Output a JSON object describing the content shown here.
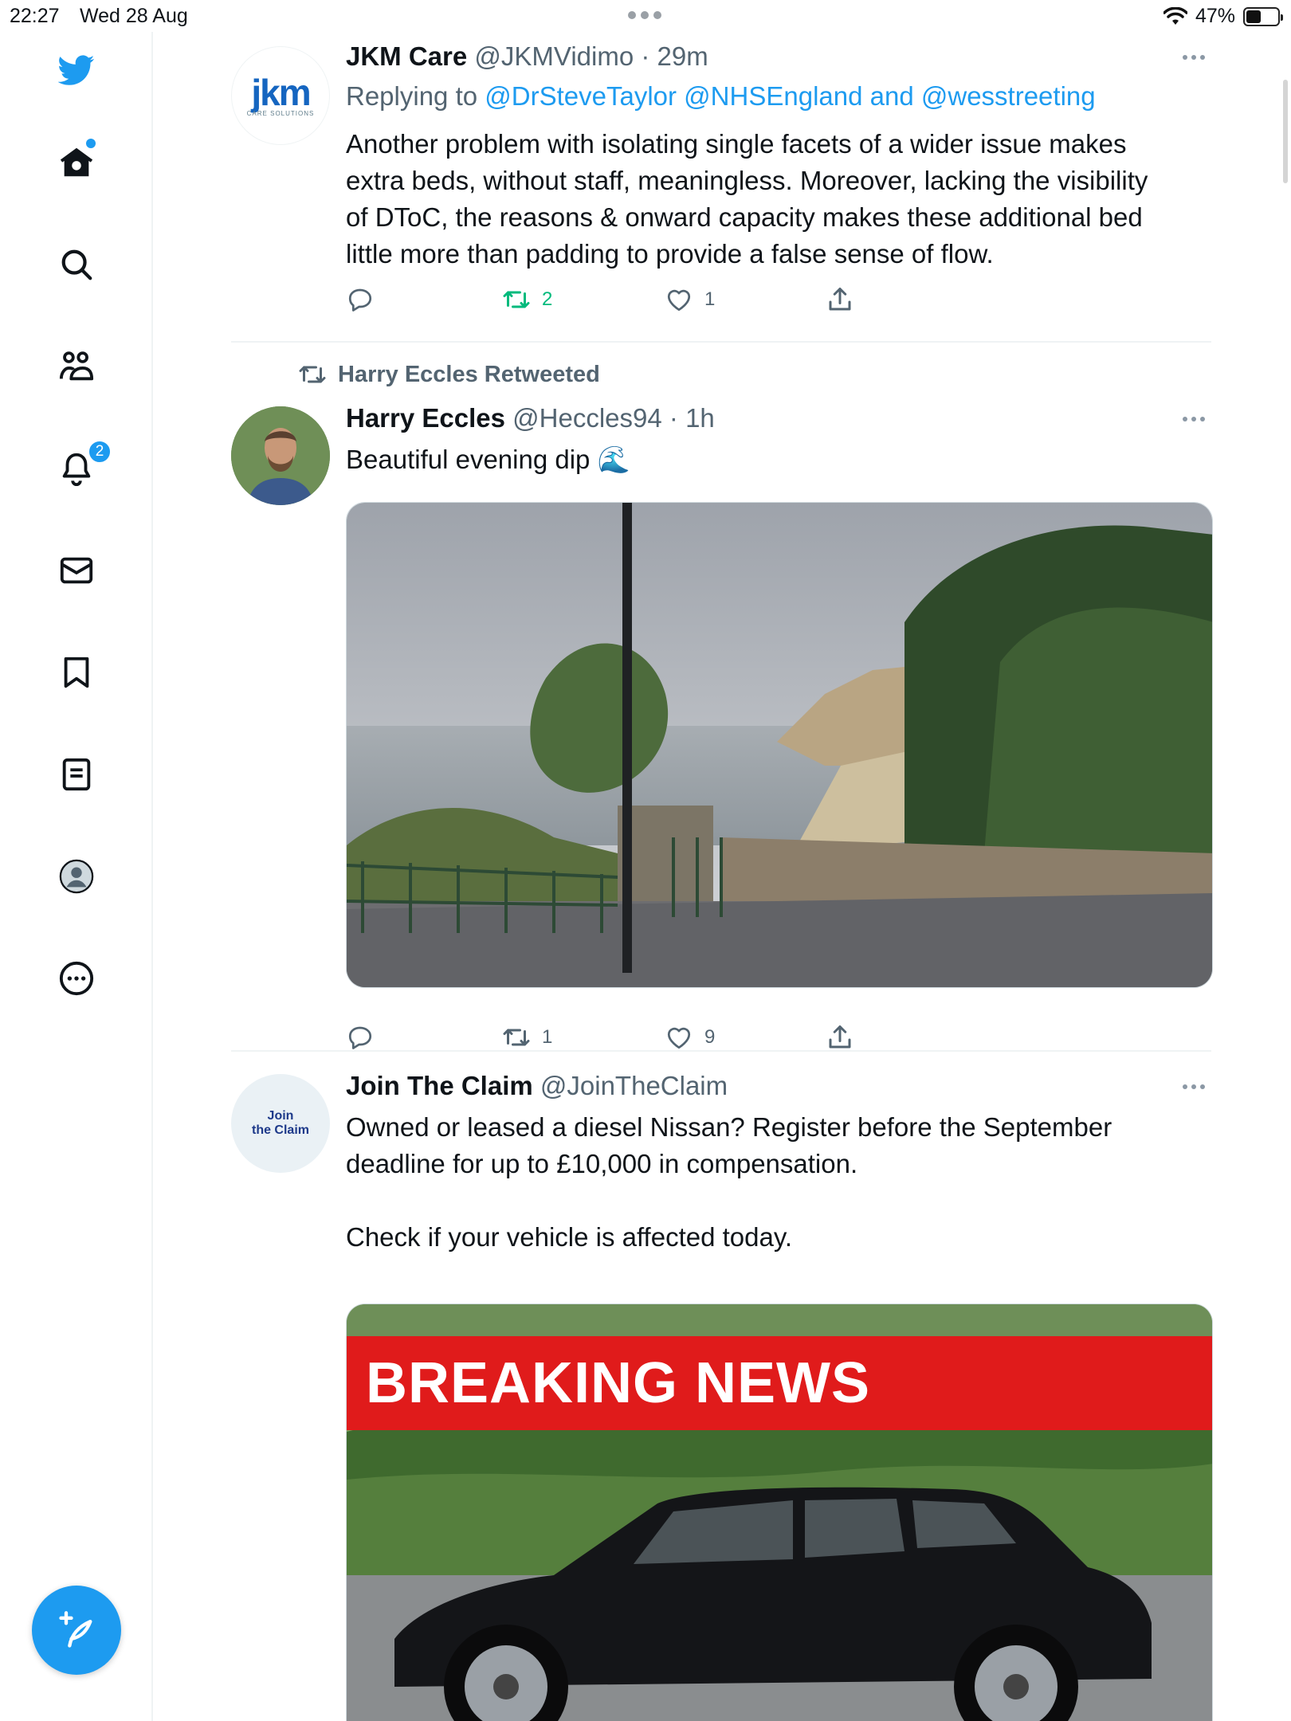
{
  "status_bar": {
    "time": "22:27",
    "date": "Wed 28 Aug",
    "battery": "47%",
    "battery_level": 0.47
  },
  "sidebar": {
    "items": [
      {
        "name": "home",
        "icon": "home-icon",
        "has_dot": true
      },
      {
        "name": "explore",
        "icon": "search-icon"
      },
      {
        "name": "communities",
        "icon": "communities-icon"
      },
      {
        "name": "notifications",
        "icon": "bell-icon",
        "badge": "2"
      },
      {
        "name": "messages",
        "icon": "envelope-icon"
      },
      {
        "name": "bookmarks",
        "icon": "bookmark-icon"
      },
      {
        "name": "lists",
        "icon": "list-icon"
      },
      {
        "name": "profile",
        "icon": "profile-icon"
      },
      {
        "name": "more",
        "icon": "more-circle-icon"
      }
    ],
    "compose_icon": "feather-plus-icon",
    "colors": {
      "accent": "#1d9bf0",
      "retweet_active": "#00ba7c"
    }
  },
  "tweets": [
    {
      "name": "JKM Care",
      "handle": "@JKMVidimo",
      "time": "· 29m",
      "avatar_logo": "jkm",
      "avatar_subtitle": "CARE SOLUTIONS",
      "replying_prefix": "Replying to",
      "replying_to": "@DrSteveTaylor @NHSEngland and @wesstreeting",
      "text_lines": [
        "Another problem with isolating single facets of a wider issue  makes",
        "extra beds, without staff, meaningless. Moreover, lacking the visibility",
        "of DToC, the reasons & onward capacity makes these additional bed",
        "little more than padding to provide a false sense of flow."
      ],
      "replies": "",
      "retweets": "2",
      "likes": "1"
    },
    {
      "retweeted_by": "Harry Eccles Retweeted",
      "name": "Harry Eccles",
      "handle": "@Heccles94",
      "time": "· 1h",
      "text": "Beautiful evening dip 🌊",
      "replies": "",
      "retweets": "1",
      "likes": "9"
    },
    {
      "name": "Join The Claim",
      "handle": "@JoinTheClaim",
      "avatar_line1": "Join",
      "avatar_line2": "the Claim",
      "text_lines": [
        "Owned or leased a diesel Nissan? Register before the September",
        "deadline for up to £10,000 in compensation."
      ],
      "text_line3": "Check if your vehicle is affected today.",
      "banner": "BREAKING NEWS"
    }
  ]
}
